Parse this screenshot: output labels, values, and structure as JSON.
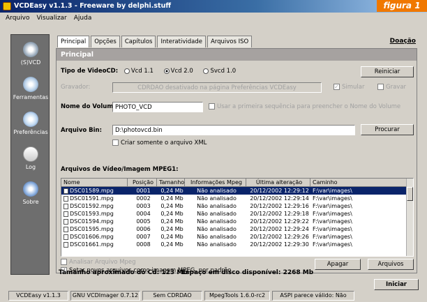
{
  "window": {
    "title": "VCDEasy v1.1.3 - Freeware by delphi.stuff",
    "overlay_label": "figura 1",
    "colors": {
      "accent": "#0a246a",
      "overlay": "#f07800"
    }
  },
  "menu": [
    "Arquivo",
    "Visualizar",
    "Ajuda"
  ],
  "sidebar": [
    {
      "label": "(S)VCD",
      "icon": "cd-icon"
    },
    {
      "label": "Ferramentas",
      "icon": "tools-icon"
    },
    {
      "label": "Preferências",
      "icon": "preferences-icon"
    },
    {
      "label": "Log",
      "icon": "log-icon"
    },
    {
      "label": "Sobre",
      "icon": "info-icon"
    }
  ],
  "tabs": [
    "Principal",
    "Opções",
    "Capítulos",
    "Interatividade",
    "Arquivos ISO"
  ],
  "donate": "Doação",
  "panel_title": "Principal",
  "vcd_type": {
    "label": "Tipo de VideoCD:",
    "options": [
      "Vcd 1.1",
      "Vcd 2.0",
      "Svcd 1.0"
    ],
    "selected": 1,
    "reset": "Reiniciar"
  },
  "burner": {
    "label": "Gravador:",
    "value": "CDRDAO desativado na página Preferências VCDEasy",
    "simulate": "Simular",
    "record": "Gravar"
  },
  "volume": {
    "label": "Nome do Volume:",
    "value": "PHOTO_VCD",
    "hint": "Usar a primeira sequência para preencher o Nome do Volume"
  },
  "bin": {
    "label": "Arquivo Bin:",
    "value": "D:\\photovcd.bin",
    "browse": "Procurar",
    "xml_only": "Criar somente o arquivo XML"
  },
  "files": {
    "label": "Arquivos de Vídeo/Imagem MPEG1:",
    "columns": [
      "Nome",
      "Posição",
      "Tamanho",
      "Informações Mpeg",
      "Última alteração",
      "Caminho"
    ],
    "rows": [
      [
        "DSC01589.mpg",
        "0001",
        "0,24 Mb",
        "Não analisado",
        "20/12/2002 12:29:12",
        "F:\\var\\images\\"
      ],
      [
        "DSC01591.mpg",
        "0002",
        "0,24 Mb",
        "Não analisado",
        "20/12/2002 12:29:14",
        "F:\\var\\images\\"
      ],
      [
        "DSC01592.mpg",
        "0003",
        "0,24 Mb",
        "Não analisado",
        "20/12/2002 12:29:16",
        "F:\\var\\images\\"
      ],
      [
        "DSC01593.mpg",
        "0004",
        "0,24 Mb",
        "Não analisado",
        "20/12/2002 12:29:18",
        "F:\\var\\images\\"
      ],
      [
        "DSC01594.mpg",
        "0005",
        "0,24 Mb",
        "Não analisado",
        "20/12/2002 12:29:22",
        "F:\\var\\images\\"
      ],
      [
        "DSC01595.mpg",
        "0006",
        "0,24 Mb",
        "Não analisado",
        "20/12/2002 12:29:24",
        "F:\\var\\images\\"
      ],
      [
        "DSC01606.mpg",
        "0007",
        "0,24 Mb",
        "Não analisado",
        "20/12/2002 12:29:26",
        "F:\\var\\images\\"
      ],
      [
        "DSC01661.mpg",
        "0008",
        "0,24 Mb",
        "Não analisado",
        "20/12/2002 12:29:30",
        "F:\\var\\images\\"
      ]
    ],
    "selected_row": 0
  },
  "analyze": "Analisar Arquivo Mpeg",
  "set_image": "Setar novos arquivos como imagem MPEG, por padrão",
  "delete": "Apagar",
  "files_btn": "Arquivos",
  "size_label": "Tamanho aproximado do Cd: 123 Mb",
  "space_label": "Espaço em disco disponível: 2268 Mb",
  "start": "Iniciar",
  "status": [
    "VCDEasy v1.1.3",
    "GNU VCDImager 0.7.12",
    "Sem CDRDAO",
    "MpegTools 1.6.0-rc2",
    "ASPI parece válido: Não"
  ]
}
